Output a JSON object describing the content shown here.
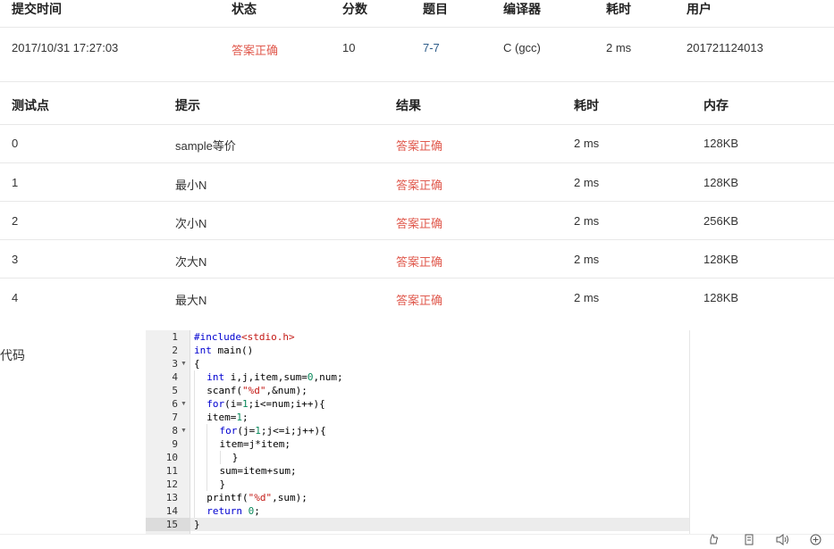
{
  "submission": {
    "headers": [
      "提交时间",
      "状态",
      "分数",
      "题目",
      "编译器",
      "耗时",
      "用户"
    ],
    "row": {
      "time": "2017/10/31 17:27:03",
      "status": "答案正确",
      "score": "10",
      "problem": "7-7",
      "compiler": "C (gcc)",
      "elapsed": "2 ms",
      "user": "201721124013"
    }
  },
  "testcases": {
    "headers": [
      "测试点",
      "提示",
      "结果",
      "耗时",
      "内存"
    ],
    "rows": [
      {
        "id": "0",
        "hint": "sample等价",
        "result": "答案正确",
        "time": "2 ms",
        "memory": "128KB"
      },
      {
        "id": "1",
        "hint": "最小N",
        "result": "答案正确",
        "time": "2 ms",
        "memory": "128KB"
      },
      {
        "id": "2",
        "hint": "次小N",
        "result": "答案正确",
        "time": "2 ms",
        "memory": "256KB"
      },
      {
        "id": "3",
        "hint": "次大N",
        "result": "答案正确",
        "time": "2 ms",
        "memory": "128KB"
      },
      {
        "id": "4",
        "hint": "最大N",
        "result": "答案正确",
        "time": "2 ms",
        "memory": "128KB"
      }
    ]
  },
  "code_section": {
    "label": "代码",
    "line_numbers": [
      "1",
      "2",
      "3",
      "4",
      "5",
      "6",
      "7",
      "8",
      "9",
      "10",
      "11",
      "12",
      "13",
      "14",
      "15"
    ],
    "lines": [
      "#include<stdio.h>",
      "int main()",
      "{",
      "int i,j,item,sum=0,num;",
      "scanf(\"%d\",&num);",
      "for(i=1;i<=num;i++){",
      "item=1;",
      "for(j=1;j<=i;j++){",
      "item=j*item;",
      "}",
      "sum=item+sum;",
      "}",
      "printf(\"%d\",sum);",
      "return 0;",
      "}"
    ]
  },
  "colors": {
    "accepted": "#e05a4e",
    "link": "#2f5d8a",
    "keyword": "#0000d0",
    "string": "#c41a16",
    "number": "#09885a"
  },
  "toolbar_icons": [
    "thumb-icon",
    "document-icon",
    "volume-icon",
    "zoom-in-icon"
  ]
}
